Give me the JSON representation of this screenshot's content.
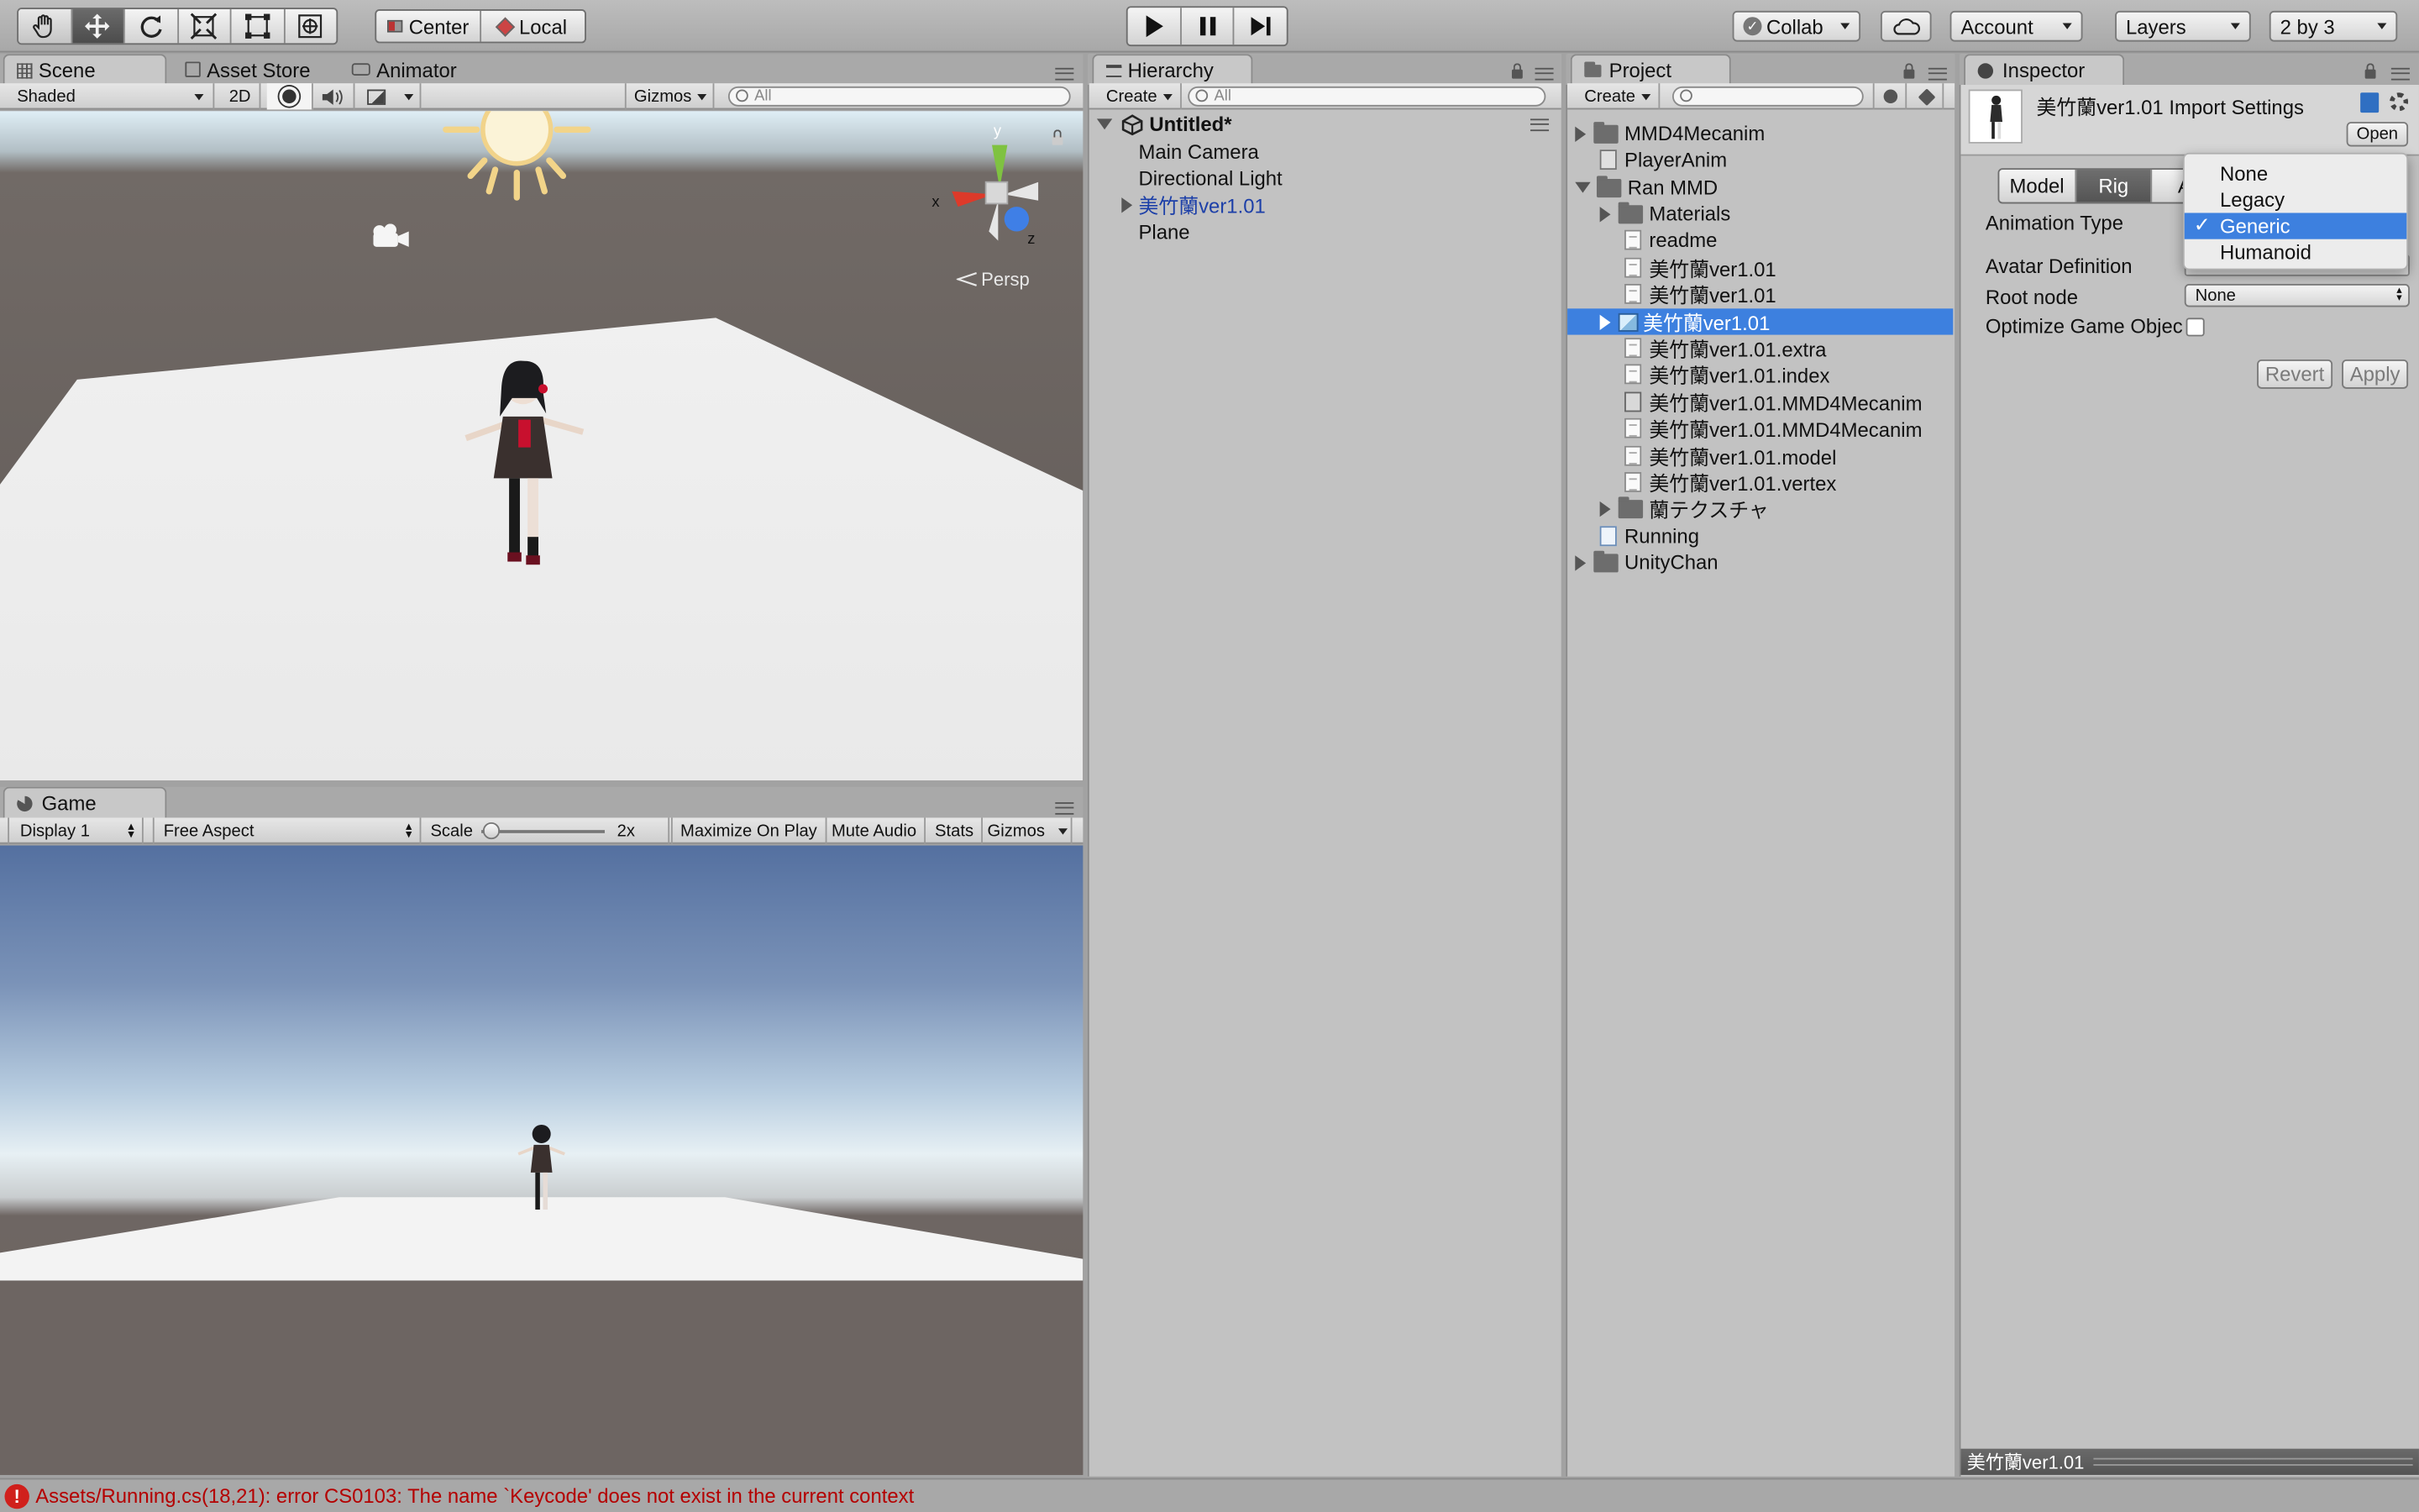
{
  "toolbar": {
    "pivot_center": "Center",
    "pivot_local": "Local",
    "collab": "Collab",
    "account": "Account",
    "layers": "Layers",
    "layout": "2 by 3"
  },
  "scene": {
    "tabs": [
      "Scene",
      "Asset Store",
      "Animator"
    ],
    "shading": "Shaded",
    "mode_2d": "2D",
    "gizmos": "Gizmos",
    "search_placeholder": "All",
    "persp": "Persp",
    "axis_x": "x",
    "axis_y": "y",
    "axis_z": "z"
  },
  "game": {
    "tab": "Game",
    "display": "Display 1",
    "aspect": "Free Aspect",
    "scale_label": "Scale",
    "scale_value": "2x",
    "scale_fraction": 0.02,
    "maximize": "Maximize On Play",
    "mute": "Mute Audio",
    "stats": "Stats",
    "gizmos": "Gizmos"
  },
  "hierarchy": {
    "tab": "Hierarchy",
    "create": "Create",
    "search_placeholder": "All",
    "scene_name": "Untitled*",
    "items": [
      "Main Camera",
      "Directional Light",
      "美竹蘭ver1.01",
      "Plane"
    ]
  },
  "project": {
    "tab": "Project",
    "create": "Create",
    "items": [
      "MMD4Mecanim",
      "PlayerAnim",
      "Ran MMD",
      "Materials",
      "readme",
      "美竹蘭ver1.01",
      "美竹蘭ver1.01",
      "美竹蘭ver1.01",
      "美竹蘭ver1.01.extra",
      "美竹蘭ver1.01.index",
      "美竹蘭ver1.01.MMD4Mecanim",
      "美竹蘭ver1.01.MMD4Mecanim",
      "美竹蘭ver1.01.model",
      "美竹蘭ver1.01.vertex",
      "蘭テクスチャ",
      "Running",
      "UnityChan"
    ]
  },
  "inspector": {
    "tab": "Inspector",
    "title": "美竹蘭ver1.01 Import Settings",
    "open": "Open",
    "tabs": [
      "Model",
      "Rig",
      "An"
    ],
    "animation_type_label": "Animation Type",
    "avatar_definition_label": "Avatar Definition",
    "root_node_label": "Root node",
    "root_node_value": "None",
    "optimize_label": "Optimize Game Object",
    "revert": "Revert",
    "apply": "Apply",
    "dropdown_options": [
      "None",
      "Legacy",
      "Generic",
      "Humanoid"
    ],
    "dropdown_selected": "Generic",
    "check_mark": "✓",
    "preview_label": "美竹蘭ver1.01"
  },
  "console": {
    "error": "Assets/Running.cs(18,21): error CS0103: The name `Keycode' does not exist in the current context",
    "error_glyph": "!"
  },
  "colors": {
    "selection": "#3d80df",
    "error_text": "#b40000",
    "link_blue": "#1c3fa8"
  }
}
